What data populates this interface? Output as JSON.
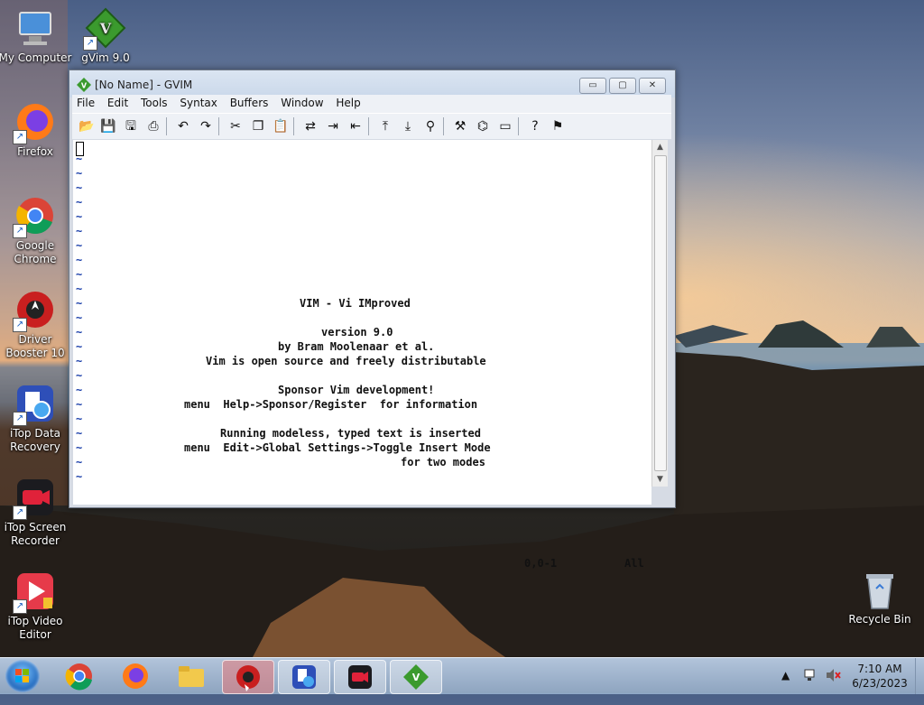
{
  "desktop": {
    "icons": [
      {
        "label": "My Computer",
        "icon": "computer-icon"
      },
      {
        "label": "gVim 9.0",
        "icon": "vim-icon"
      },
      {
        "label": "Firefox",
        "icon": "firefox-icon"
      },
      {
        "label": "Google Chrome",
        "icon": "chrome-icon"
      },
      {
        "label": "Driver Booster 10",
        "icon": "driver-booster-icon"
      },
      {
        "label": "iTop Data Recovery",
        "icon": "itop-data-recovery-icon"
      },
      {
        "label": "iTop Screen Recorder",
        "icon": "itop-screen-recorder-icon"
      },
      {
        "label": "iTop Video Editor",
        "icon": "itop-video-editor-icon"
      },
      {
        "label": "Recycle Bin",
        "icon": "recycle-bin-icon"
      }
    ]
  },
  "window": {
    "title": "[No Name] - GVIM",
    "buttons": {
      "minimize": "▭",
      "maximize": "▢",
      "close": "✕"
    }
  },
  "menu": [
    "File",
    "Edit",
    "Tools",
    "Syntax",
    "Buffers",
    "Window",
    "Help"
  ],
  "toolbar": [
    {
      "icon": "open-icon",
      "glyph": "📂"
    },
    {
      "icon": "save-icon",
      "glyph": "💾"
    },
    {
      "icon": "save-all-icon",
      "glyph": "🖫"
    },
    {
      "icon": "print-icon",
      "glyph": "⎙"
    },
    {
      "icon": "undo-icon",
      "glyph": "↶"
    },
    {
      "icon": "redo-icon",
      "glyph": "↷"
    },
    {
      "icon": "cut-icon",
      "glyph": "✂"
    },
    {
      "icon": "copy-icon",
      "glyph": "❐"
    },
    {
      "icon": "paste-icon",
      "glyph": "📋"
    },
    {
      "icon": "replace-icon",
      "glyph": "⇄"
    },
    {
      "icon": "find-next-icon",
      "glyph": "⇥"
    },
    {
      "icon": "find-prev-icon",
      "glyph": "⇤"
    },
    {
      "icon": "load-session-icon",
      "glyph": "⤒"
    },
    {
      "icon": "save-session-icon",
      "glyph": "⤓"
    },
    {
      "icon": "run-script-icon",
      "glyph": "⚲"
    },
    {
      "icon": "make-icon",
      "glyph": "⚒"
    },
    {
      "icon": "shell-icon",
      "glyph": "⌬"
    },
    {
      "icon": "tags-icon",
      "glyph": "▭"
    },
    {
      "icon": "help-icon",
      "glyph": "?"
    },
    {
      "icon": "find-help-icon",
      "glyph": "⚑"
    }
  ],
  "editor": {
    "tilde": "~",
    "lines": [
      "VIM - Vi IMproved",
      "version 9.0",
      "by Bram Moolenaar et al.",
      "Vim is open source and freely distributable",
      "Sponsor Vim development!",
      "menu  Help->Sponsor/Register  for information",
      "Running modeless, typed text is inserted",
      "menu  Edit->Global Settings->Toggle Insert Mode",
      "for two modes"
    ],
    "status_position": "0,0-1",
    "status_scroll": "All"
  },
  "taskbar": {
    "apps": [
      {
        "name": "Google Chrome",
        "icon": "chrome-icon"
      },
      {
        "name": "Firefox",
        "icon": "firefox-icon"
      },
      {
        "name": "File Explorer",
        "icon": "folder-icon"
      },
      {
        "name": "Driver Booster",
        "icon": "driver-booster-icon"
      },
      {
        "name": "iTop Data Recovery",
        "icon": "itop-data-recovery-icon"
      },
      {
        "name": "iTop Screen Recorder",
        "icon": "itop-screen-recorder-icon"
      },
      {
        "name": "GVIM",
        "icon": "vim-icon"
      }
    ],
    "time": "7:10 AM",
    "date": "6/23/2023"
  },
  "colors": {
    "vim_green": "#3b9a2e",
    "tilde_blue": "#1b3faa",
    "taskbar": "#a8bfdc"
  }
}
